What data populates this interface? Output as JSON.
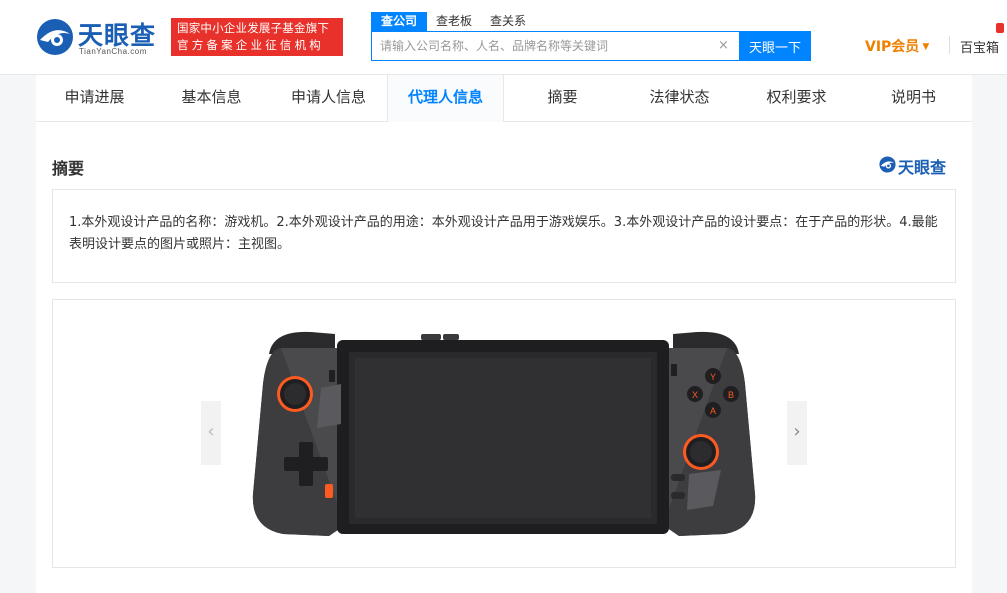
{
  "header": {
    "logo_cn": "天眼查",
    "logo_en": "TianYanCha.com",
    "gov_line1": "国家中小企业发展子基金旗下",
    "gov_line2": "官方备案企业征信机构",
    "search_tabs": [
      "查公司",
      "查老板",
      "查关系"
    ],
    "search_placeholder": "请输入公司名称、人名、品牌名称等关键词",
    "search_clear": "×",
    "search_button": "天眼一下",
    "vip_label": "VIP会员",
    "vip_caret": "▼",
    "baibao_label": "百宝箱"
  },
  "nav": {
    "items": [
      "申请进展",
      "基本信息",
      "申请人信息",
      "代理人信息",
      "摘要",
      "法律状态",
      "权利要求",
      "说明书"
    ],
    "active_index": 3
  },
  "abstract": {
    "title": "摘要",
    "brand": "天眼查",
    "text": "1.本外观设计产品的名称：游戏机。2.本外观设计产品的用途：本外观设计产品用于游戏娱乐。3.本外观设计产品的设计要点：在于产品的形状。4.最能表明设计要点的图片或照片：主视图。"
  },
  "gallery": {
    "prev_glyph": "‹",
    "next_glyph": "›",
    "button_labels": [
      "Y",
      "X",
      "B",
      "A"
    ]
  },
  "colors": {
    "brand_blue": "#0084ff",
    "logo_blue": "#1a5fb4",
    "gov_red": "#e8312a",
    "vip_orange": "#f08000",
    "device_accent": "#ff5a1f"
  }
}
